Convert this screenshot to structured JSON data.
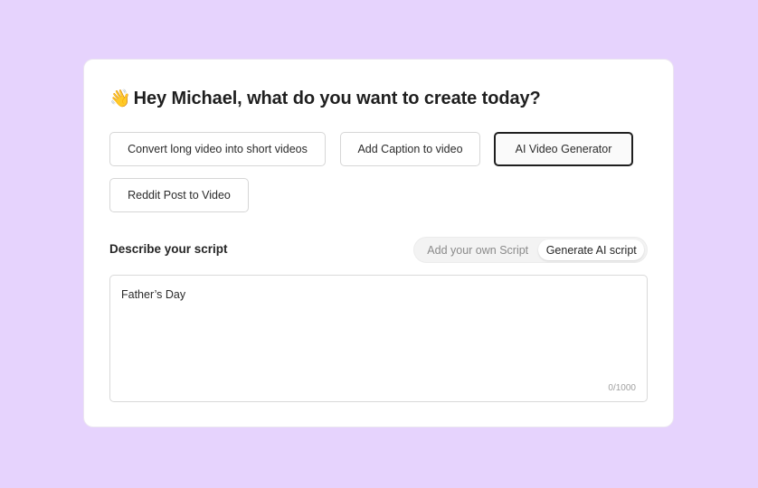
{
  "greeting": {
    "icon": "waving-hand-icon",
    "emoji": "👋",
    "text": "Hey Michael, what do you want to create today?"
  },
  "options": [
    {
      "label": "Convert long video into short videos",
      "selected": false
    },
    {
      "label": "Add Caption to video",
      "selected": false
    },
    {
      "label": "AI Video Generator",
      "selected": true
    },
    {
      "label": "Reddit Post to Video",
      "selected": false
    }
  ],
  "script_section": {
    "title": "Describe your script",
    "toggle": {
      "own_label": "Add your own Script",
      "ai_label": "Generate AI script",
      "active": "ai"
    },
    "input": {
      "value": "Father’s Day",
      "char_count": "0/1000"
    }
  },
  "colors": {
    "background": "#e6d3fd",
    "card": "#ffffff",
    "selected_border": "#1f1f1f"
  }
}
